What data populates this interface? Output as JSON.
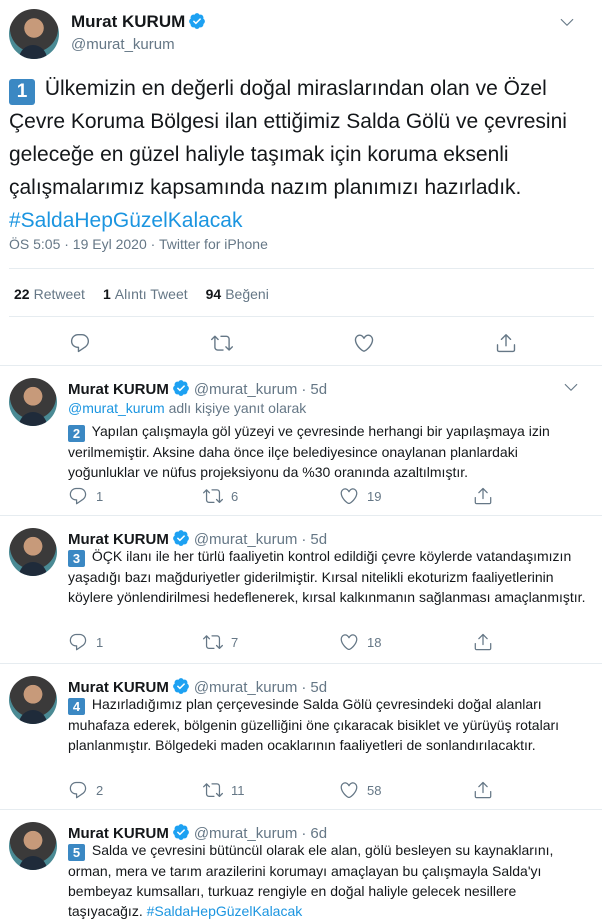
{
  "main_tweet": {
    "name": "Murat KURUM",
    "handle": "@murat_kurum",
    "badge": "1",
    "text": "Ülkemizin en değerli doğal miraslarından olan ve Özel Çevre Koruma Bölgesi ilan ettiğimiz Salda Gölü ve çevresini geleceğe en güzel haliyle taşımak için koruma eksenli çalışmalarımız kapsamında nazım planımızı hazırladık.",
    "hashtag": "#SaldaHepGüzelKalacak",
    "meta": "ÖS 5:05 · 19 Eyl 2020 · Twitter for iPhone",
    "stats": {
      "retweets": "22",
      "retweets_label": "Retweet",
      "quotes": "1",
      "quotes_label": "Alıntı Tweet",
      "likes": "94",
      "likes_label": "Beğeni"
    }
  },
  "replies": [
    {
      "name": "Murat KURUM",
      "handle": "@murat_kurum",
      "time": "5d",
      "reply_to_link": "@murat_kurum",
      "reply_to_text": "adlı kişiye yanıt olarak",
      "badge": "2",
      "text": "Yapılan çalışmayla göl yüzeyi ve çevresinde herhangi bir yapılaşmaya izin verilmemiştir. Aksine daha önce ilçe belediyesince onaylanan planlardaki yoğunluklar ve nüfus projeksiyonu da %30 oranında azaltılmıştır.",
      "replies": "1",
      "retweets": "6",
      "likes": "19"
    },
    {
      "name": "Murat KURUM",
      "handle": "@murat_kurum",
      "time": "5d",
      "badge": "3",
      "text": "ÖÇK ilanı ile her türlü faaliyetin kontrol edildiği çevre köylerde vatandaşımızın yaşadığı bazı mağduriyetler giderilmiştir. Kırsal nitelikli ekoturizm faaliyetlerinin köylere yönlendirilmesi hedeflenerek, kırsal kalkınmanın sağlanması amaçlanmıştır.",
      "replies": "1",
      "retweets": "7",
      "likes": "18"
    },
    {
      "name": "Murat KURUM",
      "handle": "@murat_kurum",
      "time": "5d",
      "badge": "4",
      "text": "Hazırladığımız plan çerçevesinde Salda Gölü çevresindeki doğal alanları muhafaza ederek, bölgenin güzelliğini öne çıkaracak bisiklet ve yürüyüş rotaları planlanmıştır. Bölgedeki maden ocaklarının faaliyetleri de sonlandırılacaktır.",
      "replies": "2",
      "retweets": "11",
      "likes": "58"
    },
    {
      "name": "Murat KURUM",
      "handle": "@murat_kurum",
      "time": "6d",
      "badge": "5",
      "text": "Salda ve çevresini bütüncül olarak ele alan, gölü besleyen su kaynaklarını, orman, mera ve tarım arazilerini korumayı amaçlayan bu çalışmayla Salda'yı bembeyaz kumsalları, turkuaz rengiyle en doğal haliyle gelecek nesillere taşıyacağız.",
      "hashtag": "#SaldaHepGüzelKalacak"
    }
  ],
  "colors": {
    "accent": "#1b95e0",
    "badge_blue": "#3b88c3",
    "secondary_text": "#657786",
    "divider": "#e6ecf0"
  },
  "icons": [
    "verified-icon",
    "chevron-down-icon",
    "reply-icon",
    "retweet-icon",
    "like-icon",
    "share-icon"
  ]
}
